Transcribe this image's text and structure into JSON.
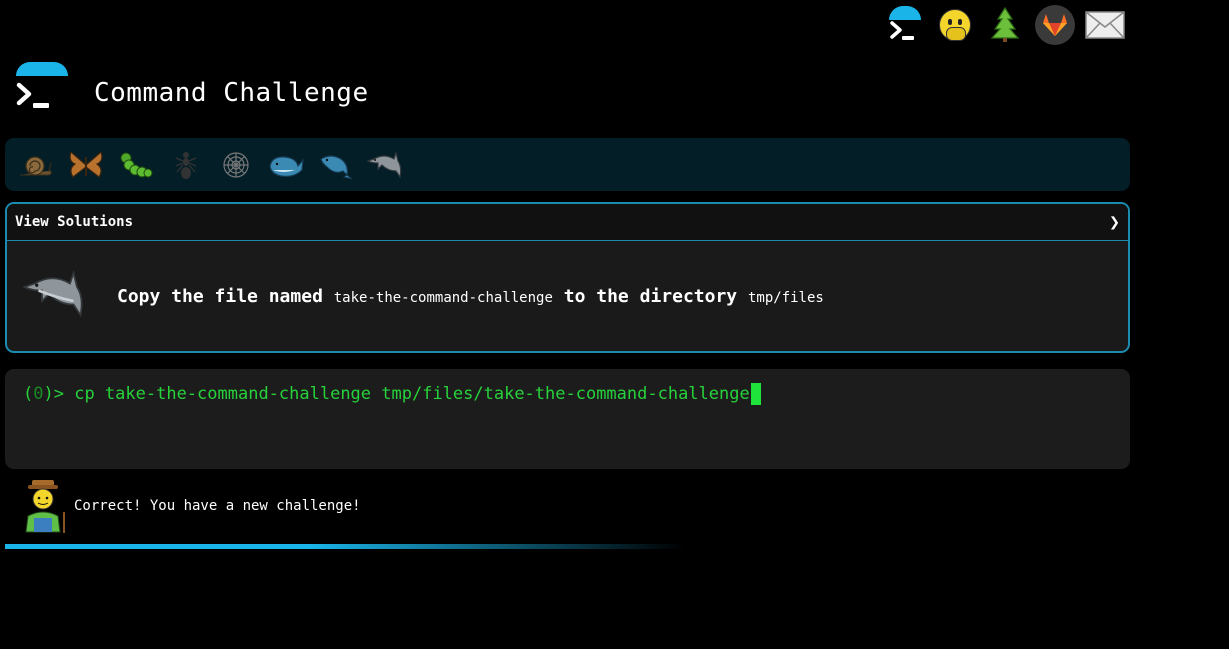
{
  "app": {
    "title": "Command Challenge"
  },
  "top_nav": {
    "items": [
      {
        "icon": "terminal-logo-icon"
      },
      {
        "icon": "hushed-face-icon"
      },
      {
        "icon": "evergreen-tree-icon"
      },
      {
        "icon": "gitlab-icon"
      },
      {
        "icon": "envelope-icon"
      }
    ]
  },
  "levels": [
    {
      "icon": "snail-icon"
    },
    {
      "icon": "butterfly-icon"
    },
    {
      "icon": "caterpillar-icon"
    },
    {
      "icon": "ant-icon"
    },
    {
      "icon": "spider-web-icon"
    },
    {
      "icon": "whale-icon"
    },
    {
      "icon": "spouting-whale-icon"
    },
    {
      "icon": "dolphin-icon"
    }
  ],
  "challenge": {
    "solutions_label": "View Solutions",
    "chevron": "❯",
    "task_prefix": "Copy the file named",
    "file_name": "take-the-command-challenge",
    "task_middle": "to the directory",
    "dir_name": "tmp/files"
  },
  "terminal": {
    "prompt_open": "(",
    "prompt_code": "0",
    "prompt_close": ")> ",
    "command": "cp take-the-command-challenge tmp/files/take-the-command-challenge"
  },
  "result": {
    "message": "Correct! You have a new challenge!"
  },
  "colors": {
    "accent": "#1ab4e8",
    "terminal_green": "#27d13a",
    "panel_border": "#1b8bb0",
    "levels_bg": "#041e28"
  }
}
